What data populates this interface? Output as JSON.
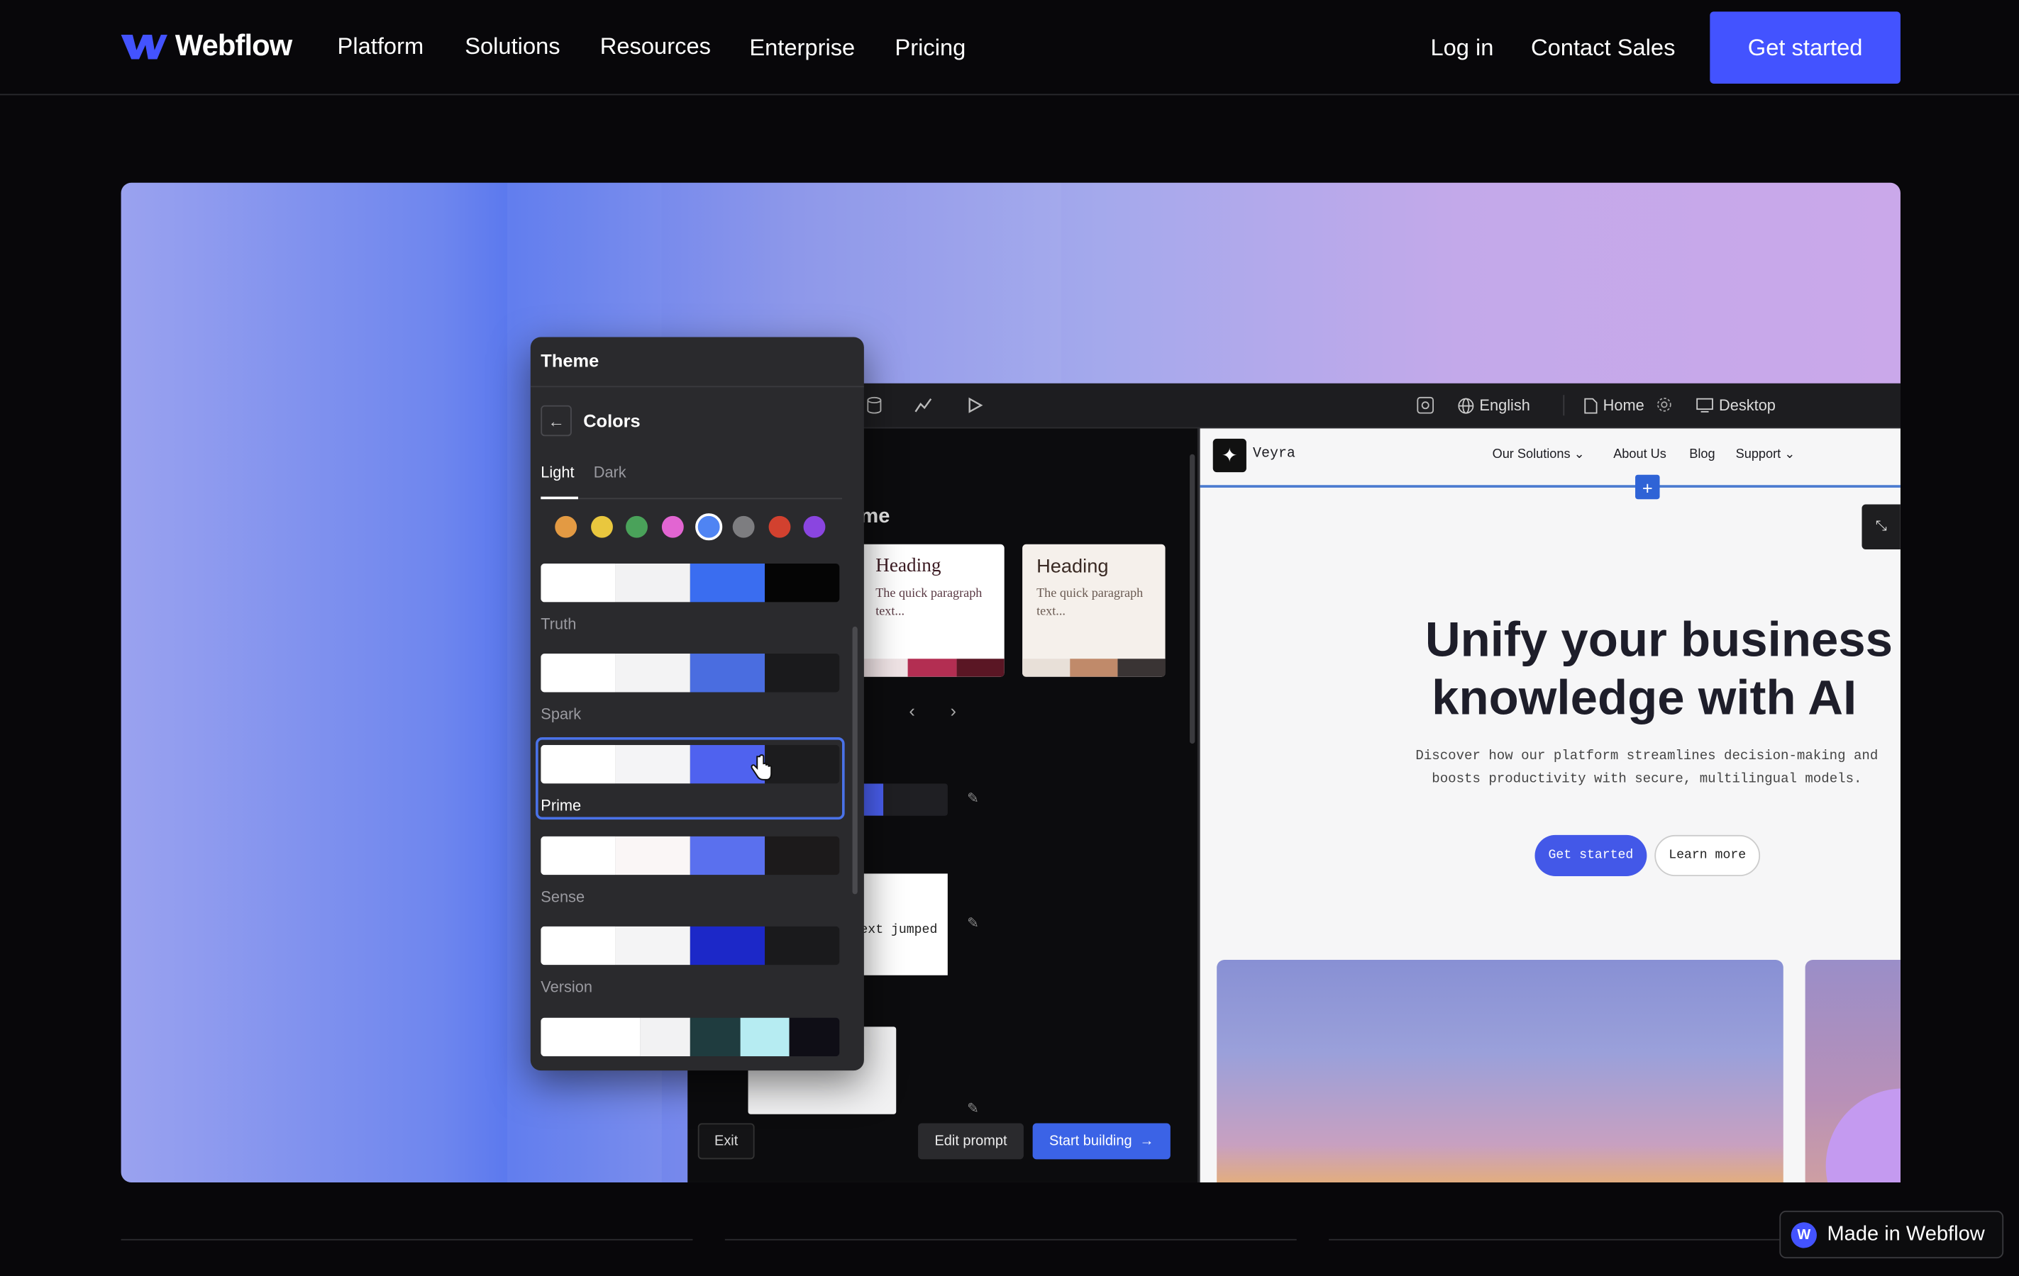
{
  "nav": {
    "brand": "Webflow",
    "links": [
      "Platform",
      "Solutions",
      "Resources",
      "Enterprise",
      "Pricing"
    ],
    "login": "Log in",
    "contact": "Contact Sales",
    "cta": "Get started"
  },
  "editor": {
    "toolbar": {
      "language": "English",
      "page": "Home",
      "device": "Desktop"
    },
    "left_heading_fragment": "me",
    "cards": [
      {
        "heading": "Heading",
        "text": "The quick paragraph text..."
      },
      {
        "heading": "Heading",
        "text": "The quick paragraph text..."
      }
    ],
    "snippet_text": "ext jumped",
    "exit": "Exit",
    "edit_prompt": "Edit prompt",
    "start_building": "Start building"
  },
  "theme_panel": {
    "title": "Theme",
    "section": "Colors",
    "tabs": [
      "Light",
      "Dark"
    ],
    "active_tab": "Light",
    "palette": [
      "#e39a43",
      "#e9c73e",
      "#4aa25a",
      "#e265d2",
      "#4f84f3",
      "#7d7d80",
      "#d2412f",
      "#8a45e0"
    ],
    "selected_palette_index": 4,
    "themes": [
      {
        "name": "Truth",
        "colors": [
          "#ffffff",
          "#f2f2f3",
          "#3a6df0",
          "#050505"
        ]
      },
      {
        "name": "Spark",
        "colors": [
          "#ffffff",
          "#f3f3f4",
          "#4a6de0",
          "#1a1a1c"
        ]
      },
      {
        "name": "Prime",
        "colors": [
          "#ffffff",
          "#f4f4f6",
          "#4f62ef",
          "#1c1c1e"
        ],
        "selected": true
      },
      {
        "name": "Sense",
        "colors": [
          "#ffffff",
          "#faf6f6",
          "#5a70ee",
          "#1c1a1b"
        ]
      },
      {
        "name": "Version",
        "colors": [
          "#ffffff",
          "#f4f4f5",
          "#1c28c8",
          "#1a1a1c"
        ]
      },
      {
        "name": "",
        "colors": [
          "#ffffff",
          "#f2f2f3",
          "#1f3c3f",
          "#b6ecf2",
          "#0f0e16"
        ]
      }
    ]
  },
  "site": {
    "brand": "Veyra",
    "nav": [
      "Our Solutions",
      "About Us",
      "Blog",
      "Support"
    ],
    "headline_line1": "Unify your business",
    "headline_line2": "knowledge with AI",
    "sub_line1": "Discover how our platform streamlines decision-making and",
    "sub_line2": "boosts productivity with secure, multilingual models.",
    "primary_btn": "Get started",
    "secondary_btn": "Learn more"
  },
  "badge": "Made in Webflow"
}
